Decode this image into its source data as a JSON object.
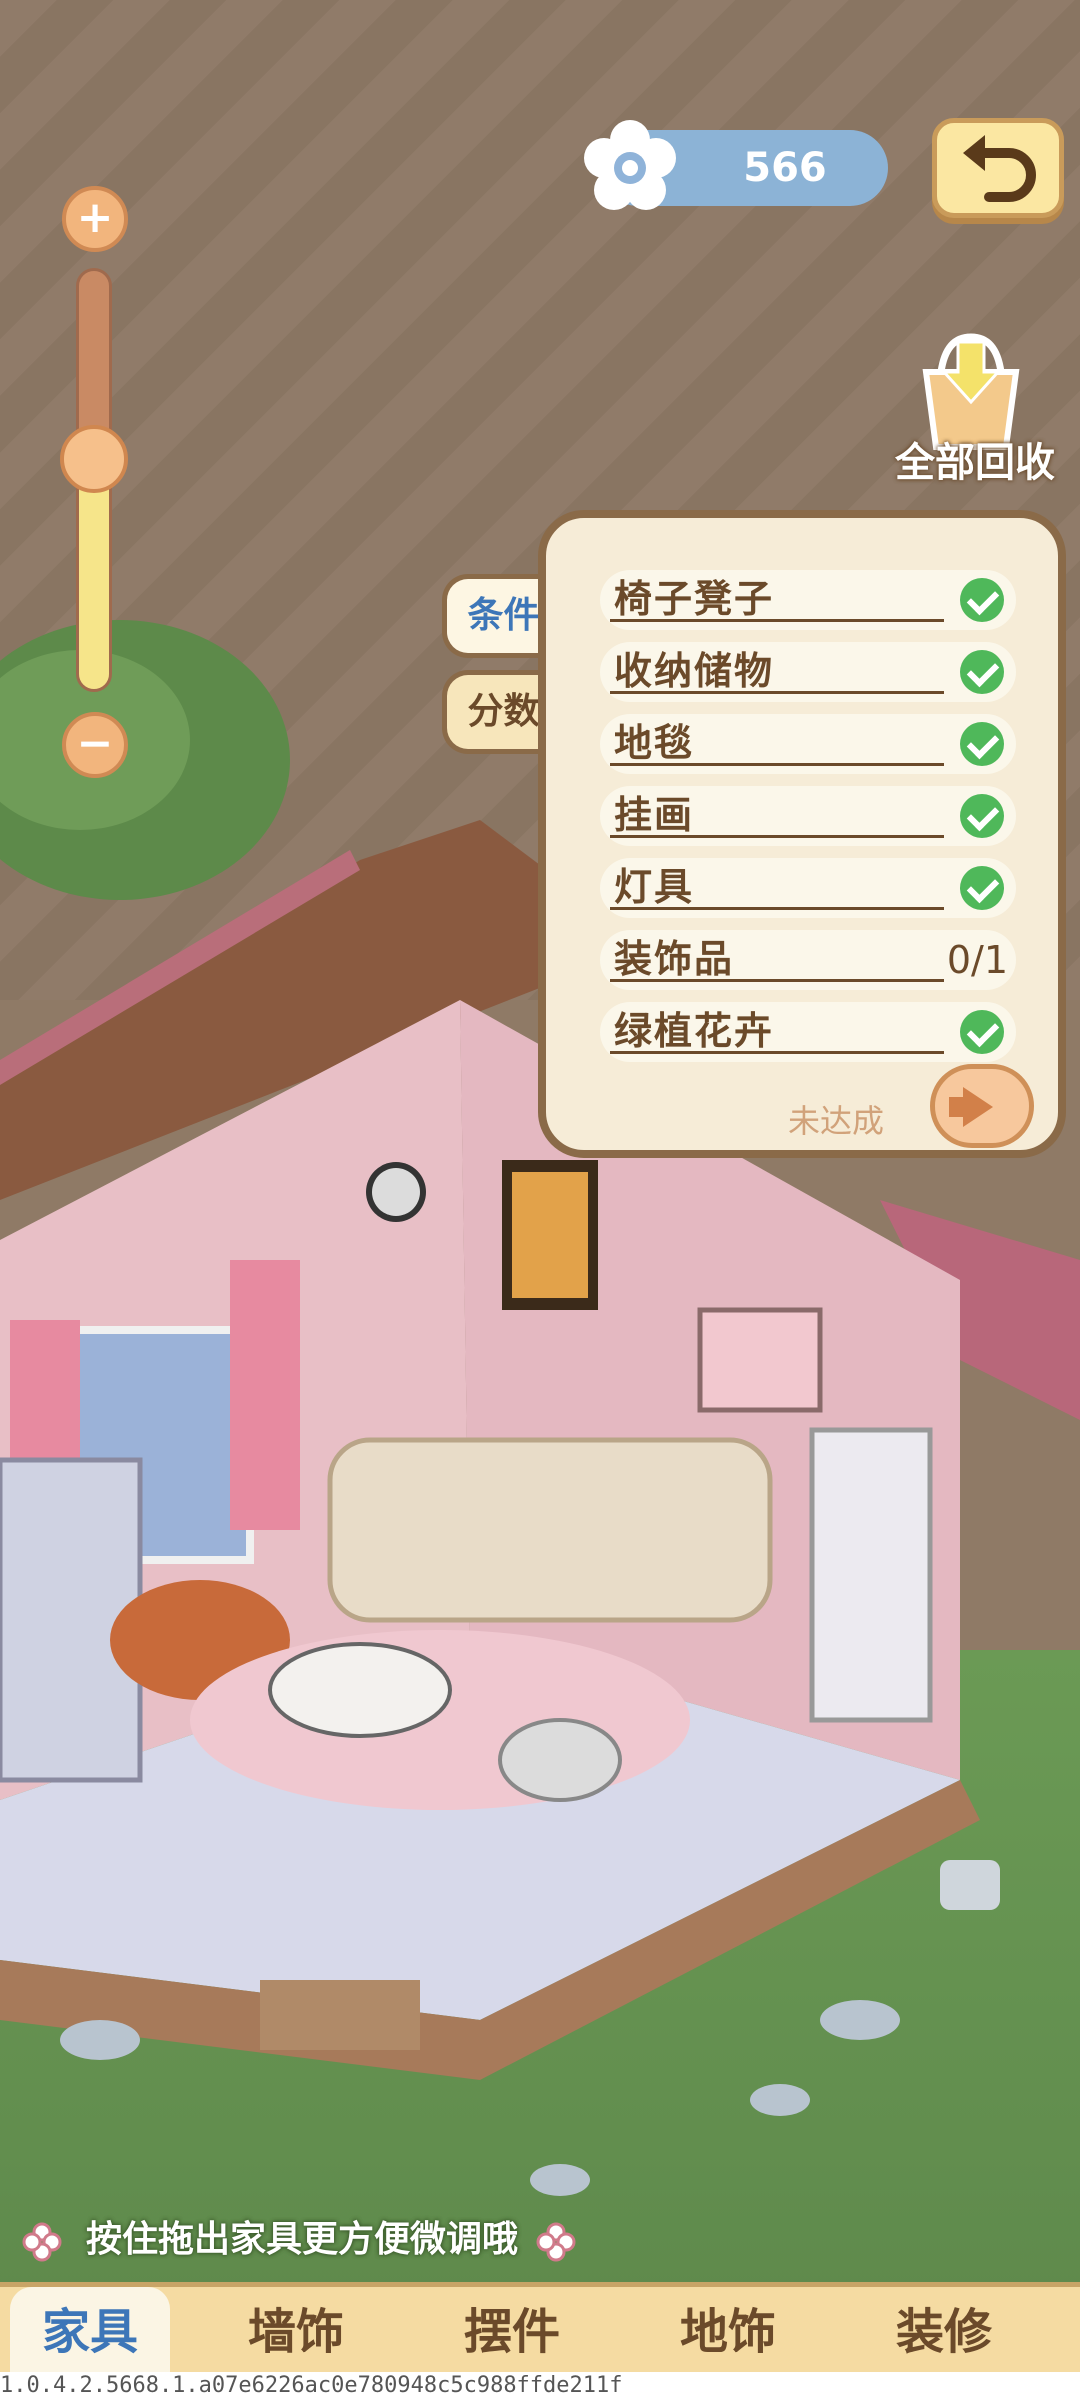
{
  "currency": {
    "value": "566",
    "icon": "flower-icon"
  },
  "zoom": {
    "level": 0.55
  },
  "recycle": {
    "label": "全部回收"
  },
  "tabs": {
    "condition": "条件",
    "score": "分数"
  },
  "conditions": [
    {
      "label": "椅子凳子",
      "done": true,
      "progress": ""
    },
    {
      "label": "收纳储物",
      "done": true,
      "progress": ""
    },
    {
      "label": "地毯",
      "done": true,
      "progress": ""
    },
    {
      "label": "挂画",
      "done": true,
      "progress": ""
    },
    {
      "label": "灯具",
      "done": true,
      "progress": ""
    },
    {
      "label": "装饰品",
      "done": false,
      "progress": "0/1"
    },
    {
      "label": "绿植花卉",
      "done": true,
      "progress": ""
    }
  ],
  "status": {
    "not_reached": "未达成"
  },
  "hint": "按住拖出家具更方便微调哦",
  "bottom_nav": [
    {
      "label": "家具",
      "active": true
    },
    {
      "label": "墙饰",
      "active": false
    },
    {
      "label": "摆件",
      "active": false
    },
    {
      "label": "地饰",
      "active": false
    },
    {
      "label": "装修",
      "active": false
    }
  ],
  "version": "1.0.4.2.5668.1.a07e6226ac0e780948c5c988ffde211f"
}
